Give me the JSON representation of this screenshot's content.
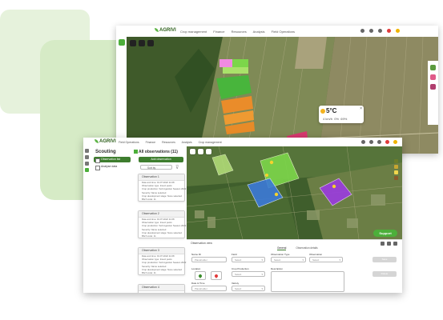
{
  "brand": {
    "name": "AGRIVI"
  },
  "back_window": {
    "nav": [
      "Crop management",
      "Finance",
      "Resources",
      "Analysis",
      "Field Operations"
    ],
    "weather": {
      "temp": "5°C",
      "wind": "4 km/h",
      "rain": "0%",
      "humidity": "69%"
    },
    "colors": {
      "accent": "#4caf3a"
    }
  },
  "front_window": {
    "nav": [
      "Field Operations",
      "Finance",
      "Resources",
      "Analysis",
      "Crop management"
    ],
    "scouting": {
      "title": "Scouting",
      "items": [
        {
          "label": "Observation list"
        },
        {
          "label": "Analyse data"
        }
      ]
    },
    "observations": {
      "title": "All observations (11)",
      "add_label": "Add observation",
      "sort_label": "Sort by",
      "cards": [
        {
          "title": "Observation 1",
          "lines": [
            "Date and time: 19.07.2022 11:08",
            "Observation type: Insect pests",
            "Crop production: Soil ingestion Season 2022",
            "Severity: Name selected",
            "Crop development stage: None selected",
            "Bbch code: 11"
          ]
        },
        {
          "title": "Observation 2",
          "lines": [
            "Date and time: 19.07.2022 11:08",
            "Observation type: Insect pests",
            "Crop production: Soil ingestion Season 2022",
            "Severity: Name selected",
            "Crop development stage: None selected",
            "Bbch code: 11"
          ]
        },
        {
          "title": "Observation 3",
          "lines": [
            "Date and time: 19.07.2022 11:08",
            "Observation type: Insect pests",
            "Crop production: Soil ingestion Season 2022",
            "Severity: Name selected",
            "Crop development stage: None selected",
            "Bbch code: 11"
          ]
        },
        {
          "title": "Observation 4",
          "lines": []
        }
      ]
    },
    "support_label": "Support",
    "form": {
      "header": "Observation view",
      "tabs": [
        "General",
        "Observation details"
      ],
      "fields": {
        "name_label": "Name ID",
        "name_placeholder": "Placeholder",
        "field_label": "Field",
        "field_value": "Select",
        "obs_type_label": "Observation Type",
        "obs_type_value": "Select",
        "observation_label": "Observation",
        "observation_value": "Select",
        "location_label": "Location",
        "crop_prod_label": "Crop Production",
        "crop_prod_value": "Select",
        "description_label": "Description",
        "datetime_label": "Date & Time",
        "datetime_placeholder": "Placeholder",
        "variety_label": "Variety",
        "variety_value": "Select"
      },
      "buttons": {
        "save": "Save",
        "delete": "Delete"
      }
    },
    "swatch_colors": [
      "#6b7d2a",
      "#c7a631",
      "#f0d64d",
      "#8a5a2b"
    ]
  },
  "back_layer_colors": [
    "#5b9a3e",
    "#e05a89",
    "#b03e6e"
  ]
}
